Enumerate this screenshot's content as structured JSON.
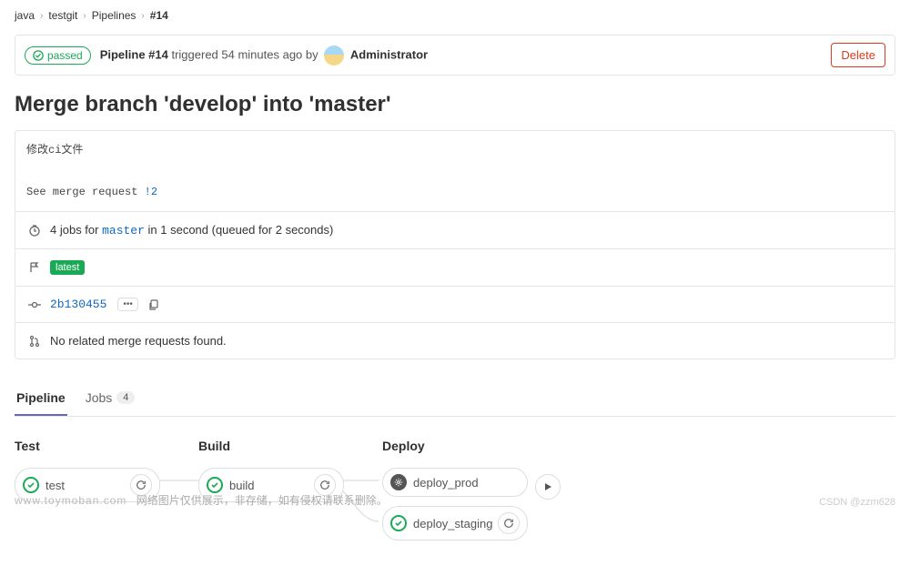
{
  "breadcrumb": {
    "items": [
      "java",
      "testgit",
      "Pipelines",
      "#14"
    ]
  },
  "header": {
    "status": "passed",
    "pipeline_label": "Pipeline #14",
    "triggered_text": " triggered 54 minutes ago by ",
    "user": "Administrator",
    "delete_label": "Delete"
  },
  "title": "Merge branch 'develop' into 'master'",
  "commit_message": {
    "line1": "修改ci文件",
    "line2_prefix": "See merge request ",
    "mr_ref": "!2"
  },
  "info": {
    "jobs_prefix": "4 jobs for ",
    "branch": "master",
    "jobs_suffix": " in 1 second (queued for 2 seconds)",
    "latest_tag": "latest",
    "commit_sha": "2b130455",
    "no_mr": "No related merge requests found."
  },
  "tabs": {
    "pipeline": "Pipeline",
    "jobs": "Jobs",
    "jobs_count": "4"
  },
  "stages": [
    {
      "name": "Test",
      "jobs": [
        {
          "name": "test",
          "status": "success",
          "action": "retry"
        }
      ]
    },
    {
      "name": "Build",
      "jobs": [
        {
          "name": "build",
          "status": "success",
          "action": "retry"
        }
      ]
    },
    {
      "name": "Deploy",
      "jobs": [
        {
          "name": "deploy_prod",
          "status": "manual",
          "action": "play"
        },
        {
          "name": "deploy_staging",
          "status": "success",
          "action": "retry"
        }
      ]
    }
  ],
  "watermark": {
    "domain": "www.toymoban.com",
    "text": "网络图片仅供展示，非存储，如有侵权请联系删除。",
    "csdn": "CSDN @zzm628"
  }
}
